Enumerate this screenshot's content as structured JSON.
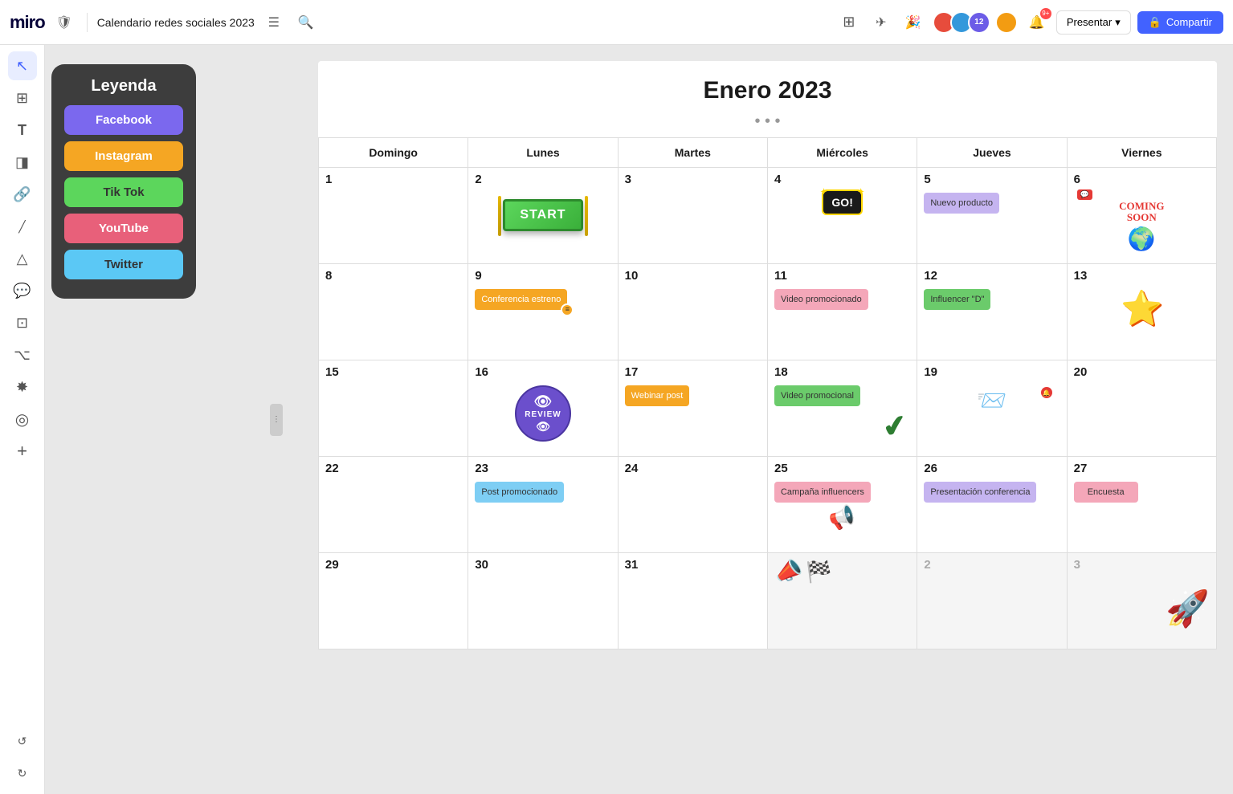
{
  "header": {
    "logo": "miro",
    "board_title": "Calendario redes sociales 2023",
    "menu_icon": "☰",
    "search_icon": "🔍",
    "present_label": "Presentar",
    "share_label": "Compartir",
    "notif_count": "9+",
    "online_count": "12"
  },
  "legend": {
    "title": "Leyenda",
    "items": [
      {
        "label": "Facebook",
        "color": "#7b68ee"
      },
      {
        "label": "Instagram",
        "color": "#f5a623"
      },
      {
        "label": "Tik Tok",
        "color": "#5cd65c"
      },
      {
        "label": "YouTube",
        "color": "#e8607a"
      },
      {
        "label": "Twitter",
        "color": "#5bc8f5"
      }
    ]
  },
  "calendar": {
    "title": "Enero 2023",
    "days_of_week": [
      "Domingo",
      "Lunes",
      "Martes",
      "Miércoles",
      "Jueves",
      "Viernes"
    ],
    "weeks": [
      [
        {
          "num": "1",
          "empty": false,
          "notes": []
        },
        {
          "num": "2",
          "empty": false,
          "notes": [],
          "special": "start"
        },
        {
          "num": "3",
          "empty": false,
          "notes": []
        },
        {
          "num": "4",
          "empty": false,
          "notes": [],
          "special": "go"
        },
        {
          "num": "5",
          "empty": false,
          "notes": [
            {
              "text": "Nuevo producto",
              "color": "purple"
            }
          ]
        },
        {
          "num": "6",
          "empty": false,
          "notes": [],
          "special": "coming_soon"
        }
      ],
      [
        {
          "num": "8",
          "empty": false,
          "notes": []
        },
        {
          "num": "9",
          "empty": false,
          "notes": [
            {
              "text": "Conferencia estreno",
              "color": "orange"
            }
          ]
        },
        {
          "num": "10",
          "empty": false,
          "notes": []
        },
        {
          "num": "11",
          "empty": false,
          "notes": [
            {
              "text": "Video promocionado",
              "color": "pink"
            }
          ]
        },
        {
          "num": "12",
          "empty": false,
          "notes": [
            {
              "text": "Influencer \"D\"",
              "color": "green"
            }
          ]
        },
        {
          "num": "13",
          "empty": false,
          "notes": [],
          "special": "star"
        }
      ],
      [
        {
          "num": "15",
          "empty": false,
          "notes": []
        },
        {
          "num": "16",
          "empty": false,
          "notes": [],
          "special": "review"
        },
        {
          "num": "17",
          "empty": false,
          "notes": [
            {
              "text": "Webinar post",
              "color": "orange"
            }
          ]
        },
        {
          "num": "18",
          "empty": false,
          "notes": [
            {
              "text": "Video promocional",
              "color": "green"
            }
          ],
          "special": "checkmark"
        },
        {
          "num": "19",
          "empty": false,
          "notes": [],
          "special": "notif"
        },
        {
          "num": "20",
          "empty": false,
          "notes": []
        }
      ],
      [
        {
          "num": "22",
          "empty": false,
          "notes": []
        },
        {
          "num": "23",
          "empty": false,
          "notes": [
            {
              "text": "Post promocionado",
              "color": "blue"
            }
          ]
        },
        {
          "num": "24",
          "empty": false,
          "notes": []
        },
        {
          "num": "25",
          "empty": false,
          "notes": [
            {
              "text": "Campaña influencers",
              "color": "pink"
            }
          ],
          "special": "important"
        },
        {
          "num": "26",
          "empty": false,
          "notes": [
            {
              "text": "Presentación conferencia",
              "color": "purple"
            }
          ]
        },
        {
          "num": "27",
          "empty": false,
          "notes": [
            {
              "text": "Encuesta",
              "color": "pink"
            }
          ]
        }
      ],
      [
        {
          "num": "29",
          "empty": false,
          "notes": []
        },
        {
          "num": "30",
          "empty": false,
          "notes": []
        },
        {
          "num": "31",
          "empty": false,
          "notes": []
        },
        {
          "num": "",
          "empty": true,
          "notes": [],
          "special": "flag"
        },
        {
          "num": "2",
          "out_of_month": true,
          "notes": []
        },
        {
          "num": "3",
          "out_of_month": true,
          "notes": [],
          "special": "rocket"
        }
      ]
    ]
  },
  "toolbar": {
    "tools": [
      {
        "name": "select",
        "icon": "↖",
        "active": true
      },
      {
        "name": "frames",
        "icon": "⊞",
        "active": false
      },
      {
        "name": "text",
        "icon": "T",
        "active": false
      },
      {
        "name": "sticky",
        "icon": "◨",
        "active": false
      },
      {
        "name": "link",
        "icon": "⊕",
        "active": false
      },
      {
        "name": "pen",
        "icon": "╱",
        "active": false
      },
      {
        "name": "shapes",
        "icon": "△",
        "active": false
      },
      {
        "name": "comment",
        "icon": "💬",
        "active": false
      },
      {
        "name": "frame2",
        "icon": "⊡",
        "active": false
      },
      {
        "name": "connector",
        "icon": "⌥",
        "active": false
      },
      {
        "name": "apps",
        "icon": "✸",
        "active": false
      },
      {
        "name": "plugins",
        "icon": "◎",
        "active": false
      },
      {
        "name": "add",
        "icon": "+",
        "active": false
      }
    ]
  }
}
